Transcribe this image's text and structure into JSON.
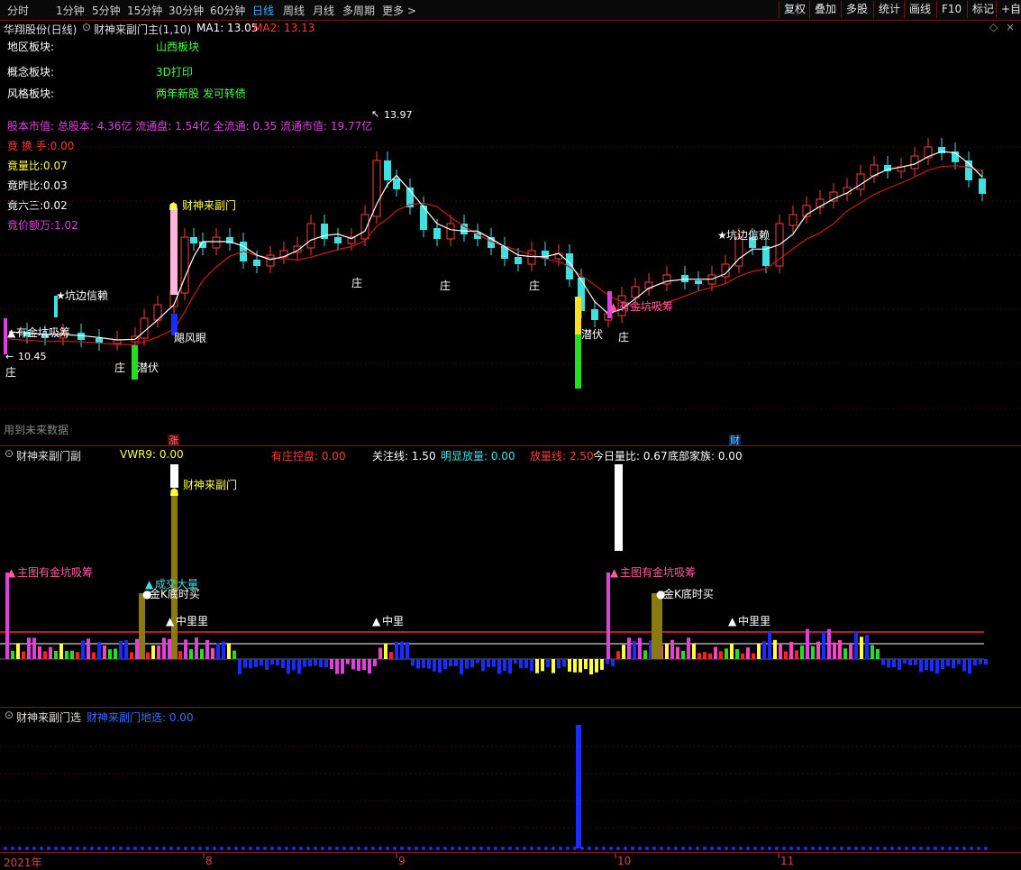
{
  "toolbar": {
    "periods": [
      "分时",
      "1分钟",
      "5分钟",
      "15分钟",
      "30分钟",
      "60分钟",
      "日线",
      "周线",
      "月线",
      "多周期",
      "更多 >"
    ],
    "active_period": "日线",
    "right_buttons": [
      "复权",
      "叠加",
      "多股",
      "统计",
      "画线",
      "F10",
      "标记",
      "+自选"
    ]
  },
  "main": {
    "stock_title": "华翔股份(日线)",
    "indicator_name": "财神来副门主(1,10)",
    "ma1_label": "MA1: 13.05",
    "ma2_label": "MA2: 13.13",
    "info_rows": [
      {
        "key": "地区板块:",
        "value": "山西板块"
      },
      {
        "key": "概念板块:",
        "value": "3D打印"
      },
      {
        "key": "风格板块:",
        "value": "两年新股 发可转债"
      }
    ],
    "capital_line": "股本市值: 总股本: 4.36亿 流通盘: 1.54亿 全流通: 0.35 流通市值: 19.77亿",
    "bid_rows": [
      {
        "text": "竟 换 手:0.00",
        "color": "#ff3a3a"
      },
      {
        "text": "竟量比:0.07",
        "color": "#ffff40"
      },
      {
        "text": "竟昨比:0.03",
        "color": "#ffffff"
      },
      {
        "text": "竟六三:0.02",
        "color": "#ffffff"
      },
      {
        "text": "竟价额万:1.02",
        "color": "#e040e0"
      }
    ],
    "high_label": "13.97",
    "low_label": "10.45",
    "future_note": "用到未来数据",
    "annotations": {
      "caishen": "财神来副门",
      "kengbian1": "坑边信赖",
      "youjin1": "有金坑吸筹",
      "jufeng": "飓风眼",
      "qianfu1": "潜伏",
      "zhuang": "庄",
      "qianfu2": "潜伏",
      "youjin2": "有金坑吸筹",
      "kengbian2": "坑边信赖"
    },
    "marker_zhang": "涨",
    "marker_cai": "财"
  },
  "sub": {
    "indicator_name": "财神来副门副",
    "fields": [
      {
        "text": "VWR9: 0.00",
        "color": "#ffff40"
      },
      {
        "text": "有庄控盘: 0.00",
        "color": "#ff3a3a"
      },
      {
        "text": "关注线: 1.50",
        "color": "#ffffff"
      },
      {
        "text": "明显放量: 0.00",
        "color": "#40e0e0"
      },
      {
        "text": "放量线: 2.50",
        "color": "#ff3a3a"
      },
      {
        "text": "今日量比: 0.67",
        "color": "#ffffff"
      },
      {
        "text": "底部家族: 0.00",
        "color": "#ffffff"
      }
    ],
    "annotations": {
      "caishen": "财神来副门",
      "zhutu1": "主图有金坑吸筹",
      "chengjiao": "成交大量",
      "jink1": "金K底时买",
      "zhongli1": "中里里",
      "zhongli2": "中里",
      "zhutu2": "主图有金坑吸筹",
      "jink2": "金K底时买",
      "zhongli3": "中里里"
    }
  },
  "select": {
    "indicator_name": "财神来副门选",
    "field": "财神来副门地选: 0.00"
  },
  "xaxis": {
    "labels": [
      "2021年",
      "8",
      "9",
      "10",
      "11"
    ]
  },
  "colors": {
    "up": "#ff3a3a",
    "down": "#40e0e0",
    "ma1": "#ffffff",
    "ma2": "#d01818",
    "border": "#8a1212"
  }
}
